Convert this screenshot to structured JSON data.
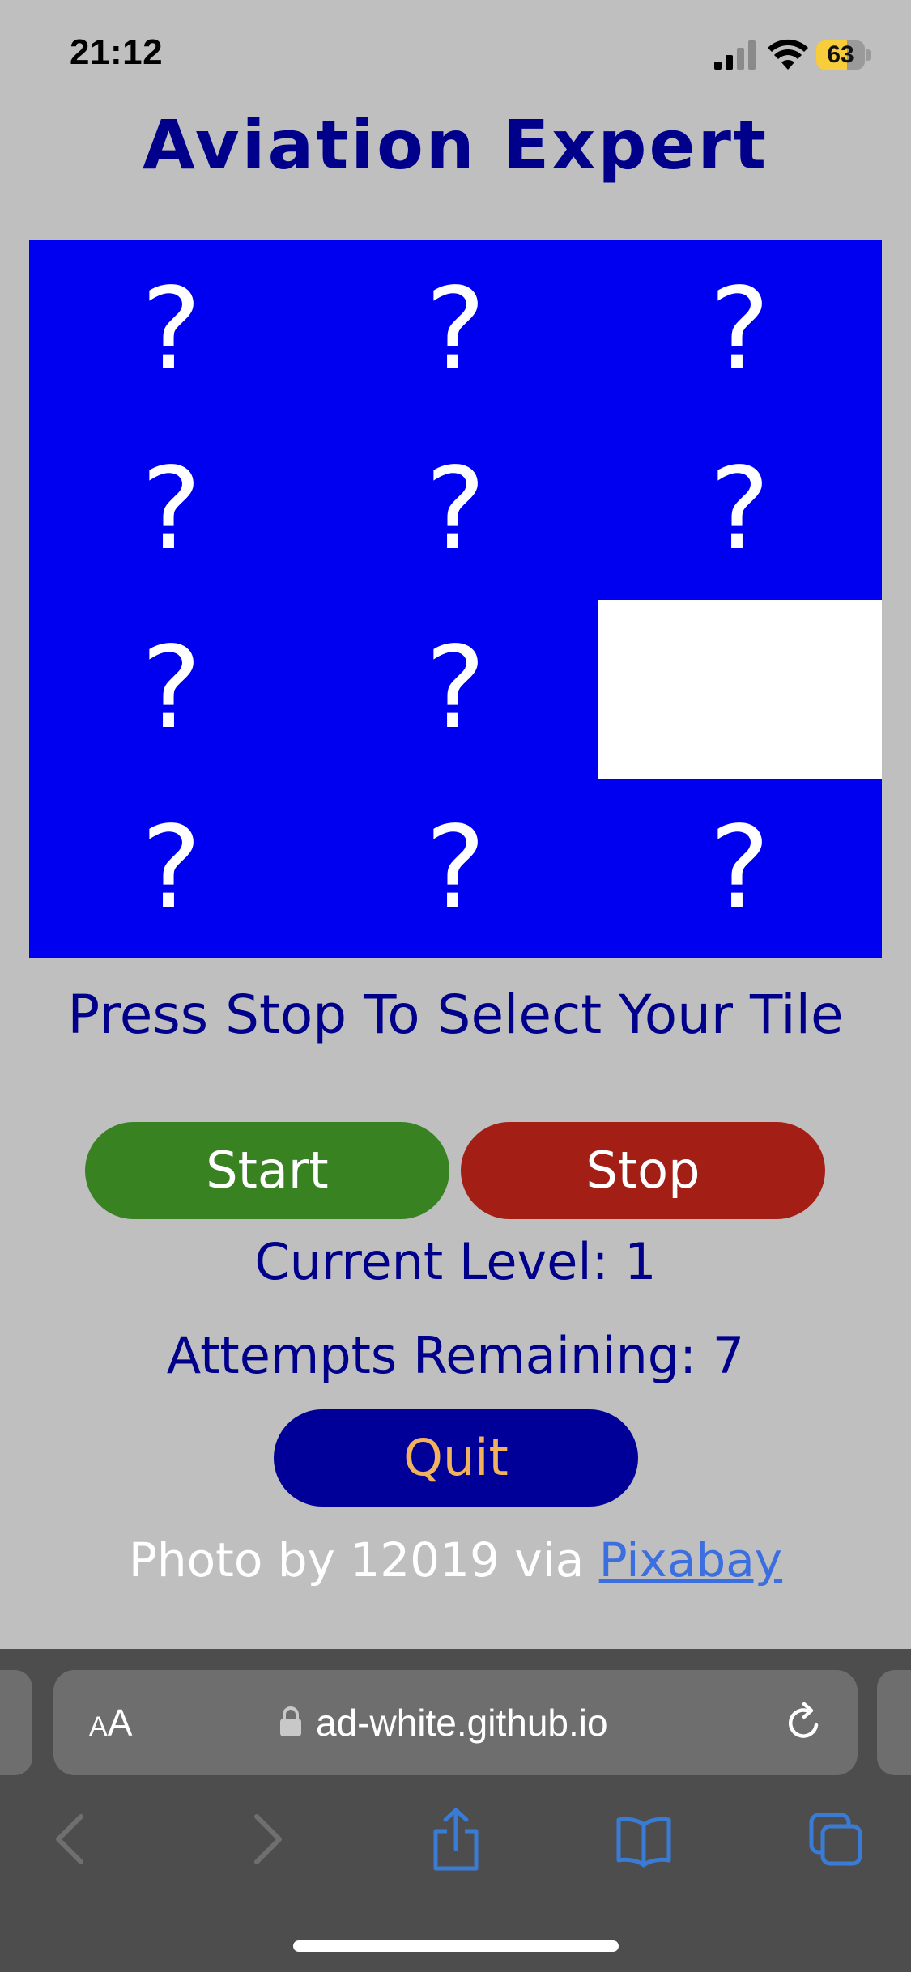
{
  "status_bar": {
    "time": "21:12",
    "battery_level": "63",
    "battery_fraction": 0.63
  },
  "game": {
    "title": "Aviation Expert",
    "tiles": [
      "?",
      "?",
      "?",
      "?",
      "?",
      "?",
      "?",
      "?",
      "",
      "?",
      "?",
      "?"
    ],
    "instruction": "Press Stop To Select Your Tile",
    "start_label": "Start",
    "stop_label": "Stop",
    "level_text": "Current Level: 1",
    "attempts_text": "Attempts Remaining: 7",
    "quit_label": "Quit",
    "credit_prefix": "Photo by 12019 via ",
    "credit_link": "Pixabay"
  },
  "browser": {
    "aa_small": "A",
    "aa_large": "A",
    "url": "ad-white.github.io"
  },
  "colors": {
    "background": "#bfbfbf",
    "tile_blue": "#0000f0",
    "title_navy": "#00008b",
    "start_green": "#388222",
    "stop_red": "#a31e15",
    "quit_blue": "#000099",
    "quit_text": "#f2b15c",
    "link_blue": "#3b6fe0"
  },
  "icons": {
    "signal": "cellular-signal-icon",
    "wifi": "wifi-icon",
    "battery": "battery-icon",
    "lock": "lock-icon",
    "reload": "reload-icon",
    "back": "chevron-left-icon",
    "forward": "chevron-right-icon",
    "share": "share-icon",
    "bookmarks": "book-icon",
    "tabs": "tabs-icon"
  }
}
